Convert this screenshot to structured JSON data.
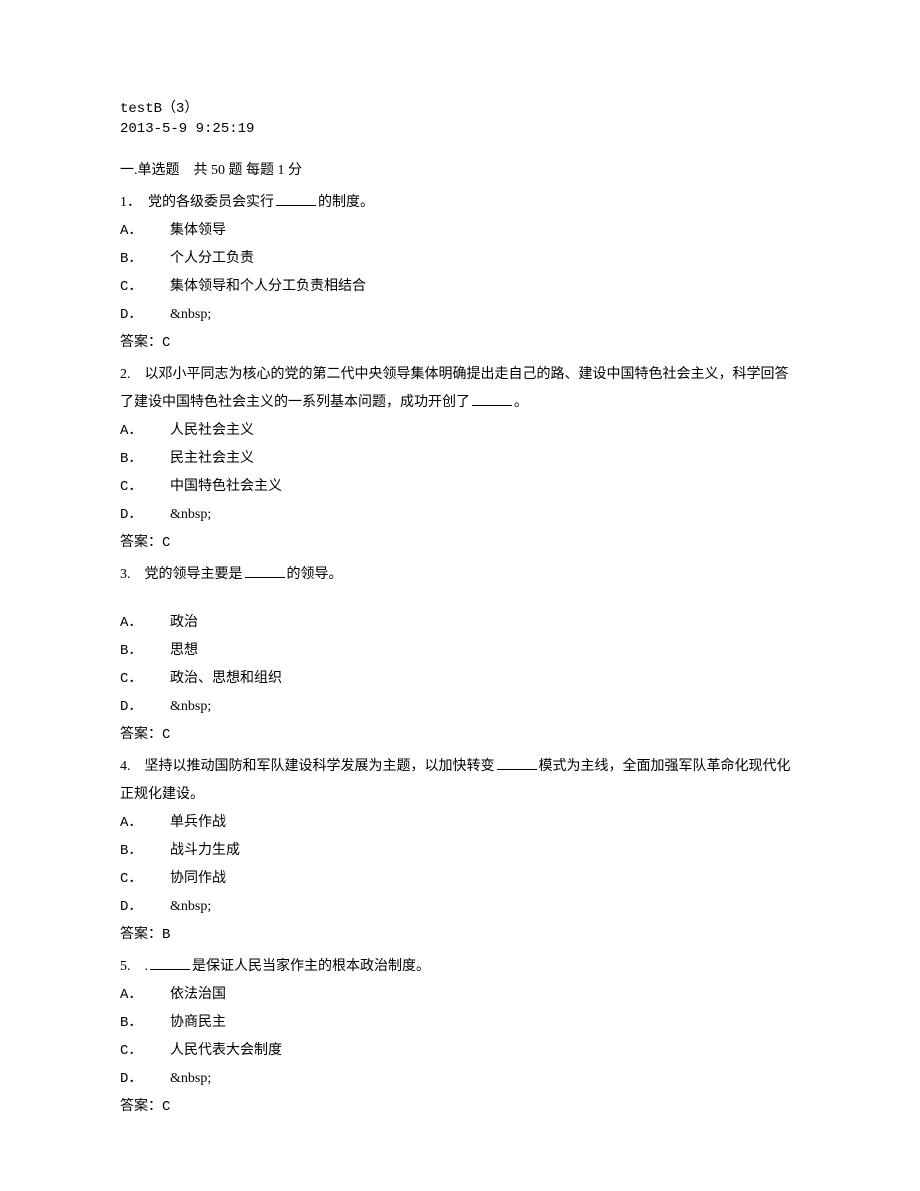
{
  "header": {
    "title": "testB（3）",
    "timestamp": "2013-5-9 9:25:19"
  },
  "section": {
    "title_prefix": "一.单选题",
    "title_suffix": "共 50 题 每题 1 分"
  },
  "questions": [
    {
      "num": "1．",
      "text_before": "党的各级委员会实行",
      "text_after": "的制度。",
      "options": [
        {
          "label": "A．",
          "text": "集体领导"
        },
        {
          "label": "B．",
          "text": "个人分工负责"
        },
        {
          "label": "C．",
          "text": "集体领导和个人分工负责相结合"
        },
        {
          "label": "D．",
          "text": "&nbsp;"
        }
      ],
      "answer_label": "答案：",
      "answer": "C"
    },
    {
      "num": "2.",
      "text_before": "以邓小平同志为核心的党的第二代中央领导集体明确提出走自己的路、建设中国特色社会主义，科学回答了建设中国特色社会主义的一系列基本问题，成功开创了",
      "text_after": "。",
      "options": [
        {
          "label": "A．",
          "text": "人民社会主义"
        },
        {
          "label": "B．",
          "text": "民主社会主义"
        },
        {
          "label": "C．",
          "text": "中国特色社会主义"
        },
        {
          "label": "D．",
          "text": "&nbsp;"
        }
      ],
      "answer_label": "答案：",
      "answer": "C"
    },
    {
      "num": "3.",
      "text_before": "党的领导主要是",
      "text_after": "的领导。",
      "extra_gap": true,
      "options": [
        {
          "label": "A．",
          "text": "政治"
        },
        {
          "label": "B．",
          "text": "思想"
        },
        {
          "label": "C．",
          "text": "政治、思想和组织"
        },
        {
          "label": "D．",
          "text": "&nbsp;"
        }
      ],
      "answer_label": "答案：",
      "answer": "C"
    },
    {
      "num": "4.",
      "text_before": "坚持以推动国防和军队建设科学发展为主题，以加快转变",
      "text_after": "模式为主线，全面加强军队革命化现代化正规化建设。",
      "options": [
        {
          "label": "A．",
          "text": "单兵作战"
        },
        {
          "label": "B．",
          "text": "战斗力生成"
        },
        {
          "label": "C．",
          "text": "协同作战"
        },
        {
          "label": "D．",
          "text": "&nbsp;"
        }
      ],
      "answer_label": "答案：",
      "answer": "B"
    },
    {
      "num": "5.",
      "text_before": ".",
      "blank_first": true,
      "text_after": "是保证人民当家作主的根本政治制度。",
      "options": [
        {
          "label": "A．",
          "text": "依法治国"
        },
        {
          "label": "B．",
          "text": "协商民主"
        },
        {
          "label": "C．",
          "text": "人民代表大会制度"
        },
        {
          "label": "D．",
          "text": "&nbsp;"
        }
      ],
      "answer_label": "答案：",
      "answer": "C"
    }
  ]
}
